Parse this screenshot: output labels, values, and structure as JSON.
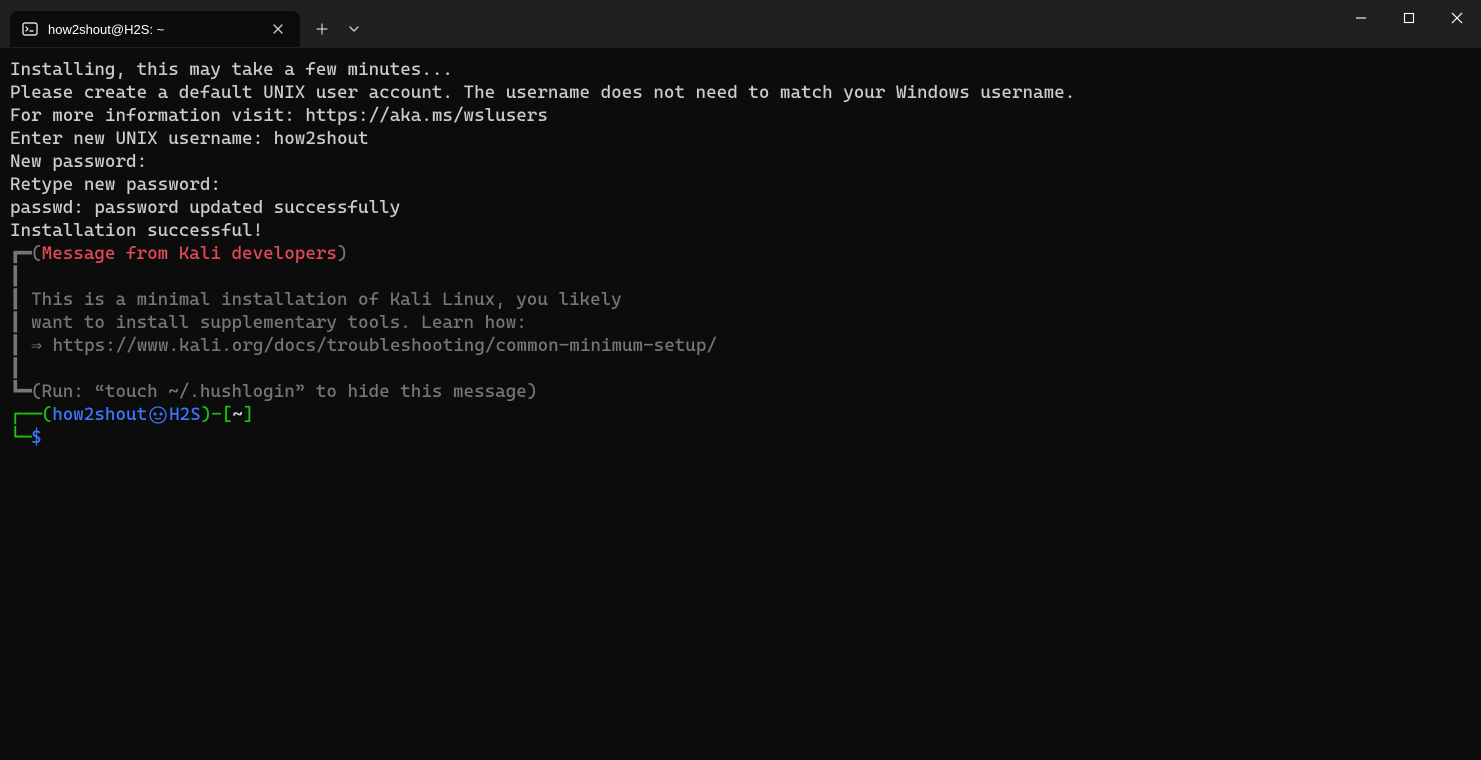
{
  "tab": {
    "title": "how2shout@H2S: ~"
  },
  "terminal": {
    "lines": {
      "l1": "Installing, this may take a few minutes...",
      "l2": "Please create a default UNIX user account. The username does not need to match your Windows username.",
      "l3": "For more information visit: https://aka.ms/wslusers",
      "l4": "Enter new UNIX username: how2shout",
      "l5": "New password:",
      "l6": "Retype new password:",
      "l7": "passwd: password updated successfully",
      "l8": "Installation successful!"
    },
    "box": {
      "header_prefix": "┏━(",
      "header_text": "Message from Kali developers",
      "header_suffix": ")",
      "pipe": "┃",
      "msg1": "┃ This is a minimal installation of Kali Linux, you likely",
      "msg2": "┃ want to install supplementary tools. Learn how:",
      "msg3": "┃ ⇒ https://www.kali.org/docs/troubleshooting/common-minimum-setup/",
      "footer_prefix": "┗━(",
      "footer_text": "Run: “touch ~/.hushlogin” to hide this message",
      "footer_suffix": ")"
    },
    "prompt": {
      "corner_top": "┌──",
      "paren_open": "(",
      "user": "how2shout",
      "host": "H2S",
      "paren_close": ")",
      "dash": "-",
      "bracket_open": "[",
      "path": "~",
      "bracket_close": "]",
      "corner_bottom": "└─",
      "symbol": "$"
    }
  }
}
